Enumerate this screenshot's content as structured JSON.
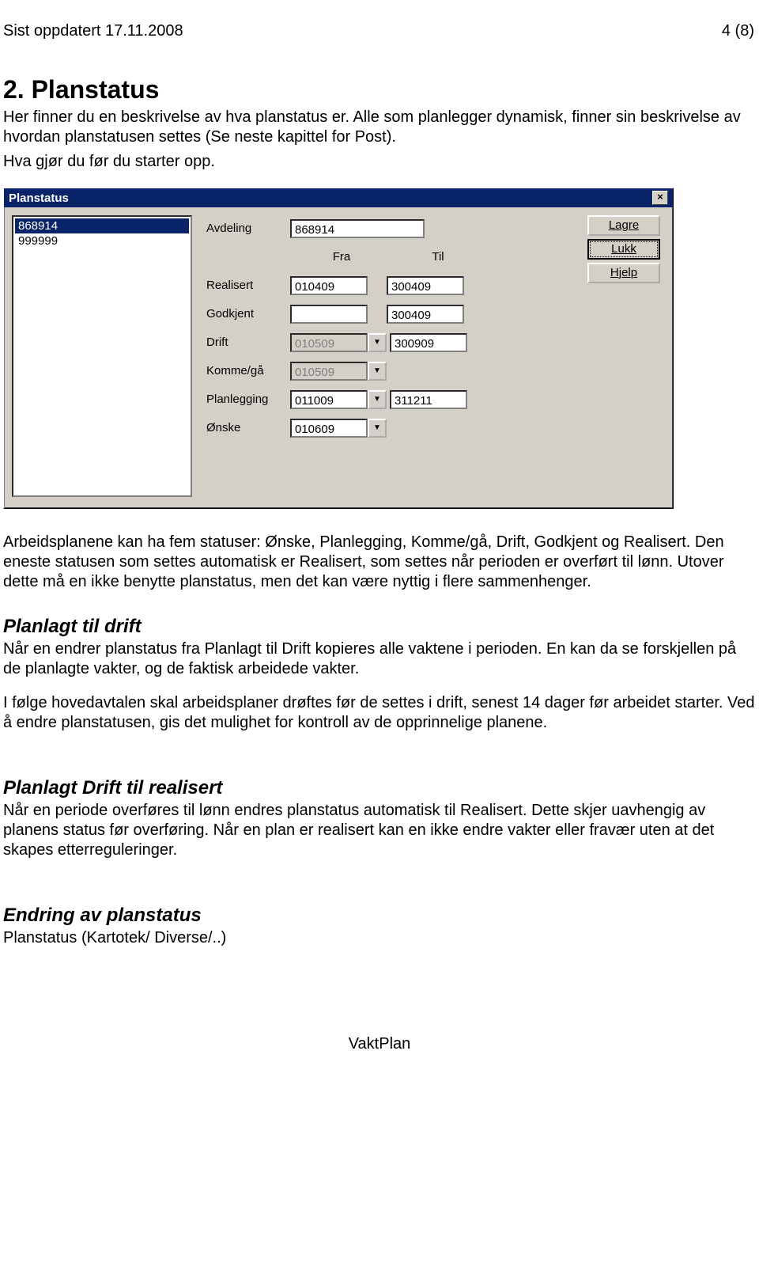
{
  "header": {
    "left": "Sist oppdatert 17.11.2008",
    "right": "4 (8)"
  },
  "section": {
    "title": "2.  Planstatus",
    "p1": "Her finner du en beskrivelse av hva planstatus er. Alle som planlegger dynamisk, finner sin beskrivelse av hvordan planstatusen settes (Se neste kapittel for Post).",
    "p2": "Hva gjør du før du starter opp."
  },
  "dialog": {
    "title": "Planstatus",
    "buttons": {
      "save": "Lagre",
      "close": "Lukk",
      "help": "Hjelp"
    },
    "list": [
      "868914",
      "999999"
    ],
    "cols": {
      "fra": "Fra",
      "til": "Til"
    },
    "rows": {
      "avdeling": {
        "label": "Avdeling",
        "value": "868914"
      },
      "realisert": {
        "label": "Realisert",
        "fra": "010409",
        "til": "300409"
      },
      "godkjent": {
        "label": "Godkjent",
        "fra": "",
        "til": "300409"
      },
      "drift": {
        "label": "Drift",
        "fra": "010509",
        "til": "300909"
      },
      "kommega": {
        "label": "Komme/gå",
        "fra": "010509"
      },
      "planlegging": {
        "label": "Planlegging",
        "fra": "011009",
        "til": "311211"
      },
      "onske": {
        "label": "Ønske",
        "fra": "010609"
      }
    }
  },
  "body2": {
    "p1": "Arbeidsplanene kan ha fem statuser: Ønske, Planlegging, Komme/gå, Drift, Godkjent og Realisert. Den eneste statusen som settes automatisk er Realisert, som settes når perioden er overført til lønn. Utover dette må en ikke benytte planstatus, men det kan være nyttig i flere sammenhenger."
  },
  "s_drift": {
    "title": "Planlagt til drift",
    "p1": "Når en endrer planstatus fra Planlagt til Drift kopieres alle vaktene i perioden. En kan da se forskjellen på de planlagte vakter, og de faktisk arbeidede vakter.",
    "p2": "I følge hovedavtalen skal arbeidsplaner drøftes før de settes i drift, senest 14 dager før arbeidet starter. Ved å endre planstatusen, gis det mulighet for kontroll av de opprinnelige planene."
  },
  "s_real": {
    "title": "Planlagt Drift til realisert",
    "p1": "Når en periode overføres til lønn endres planstatus automatisk til Realisert. Dette skjer uavhengig av planens status før overføring. Når en plan er realisert kan en ikke endre vakter eller fravær uten at det skapes etterreguleringer."
  },
  "s_endr": {
    "title": "Endring av planstatus",
    "p1": "Planstatus (Kartotek/ Diverse/..)"
  },
  "footer": "VaktPlan"
}
